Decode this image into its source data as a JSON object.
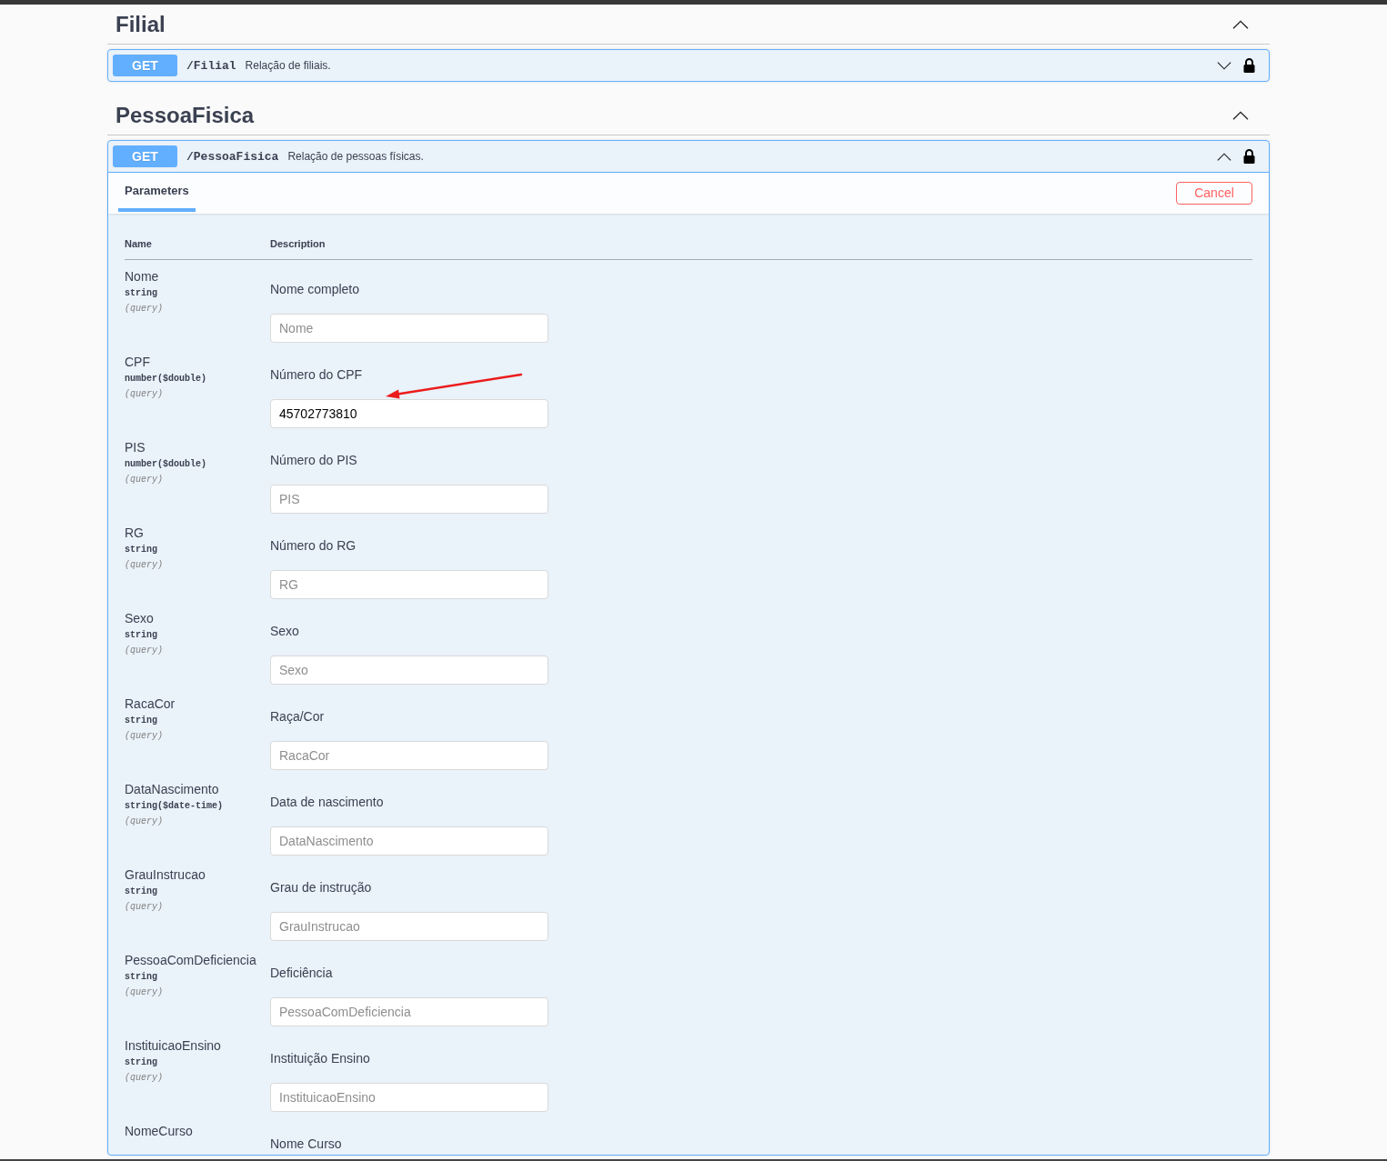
{
  "sections": [
    {
      "title": "Filial",
      "expanded": true,
      "operations": [
        {
          "method": "GET",
          "path": "/Filial",
          "summary": "Relação de filiais.",
          "expanded": false,
          "locked": true
        }
      ]
    },
    {
      "title": "PessoaFisica",
      "expanded": true,
      "operations": [
        {
          "method": "GET",
          "path": "/PessoaFisica",
          "summary": "Relação de pessoas físicas.",
          "expanded": true,
          "locked": true,
          "tabs": [
            {
              "label": "Parameters",
              "selected": true
            }
          ],
          "cancel_button": "Cancel",
          "parameters_table": {
            "columns": [
              "Name",
              "Description"
            ],
            "rows": [
              {
                "name": "Nome",
                "type": "string",
                "location": "(query)",
                "description": "Nome completo",
                "input": {
                  "placeholder": "Nome"
                },
                "annotated": false
              },
              {
                "name": "CPF",
                "type": "number($double)",
                "location": "(query)",
                "description": "Número do CPF",
                "input": {
                  "value": "45702773810"
                },
                "annotated": true
              },
              {
                "name": "PIS",
                "type": "number($double)",
                "location": "(query)",
                "description": "Número do PIS",
                "input": {
                  "placeholder": "PIS"
                },
                "annotated": false
              },
              {
                "name": "RG",
                "type": "string",
                "location": "(query)",
                "description": "Número do RG",
                "input": {
                  "placeholder": "RG"
                },
                "annotated": false
              },
              {
                "name": "Sexo",
                "type": "string",
                "location": "(query)",
                "description": "Sexo",
                "input": {
                  "placeholder": "Sexo"
                },
                "annotated": false
              },
              {
                "name": "RacaCor",
                "type": "string",
                "location": "(query)",
                "description": "Raça/Cor",
                "input": {
                  "placeholder": "RacaCor"
                },
                "annotated": false
              },
              {
                "name": "DataNascimento",
                "type": "string($date-time)",
                "location": "(query)",
                "description": "Data de nascimento",
                "input": {
                  "placeholder": "DataNascimento"
                },
                "annotated": false
              },
              {
                "name": "GrauInstrucao",
                "type": "string",
                "location": "(query)",
                "description": "Grau de instrução",
                "input": {
                  "placeholder": "GrauInstrucao"
                },
                "annotated": false
              },
              {
                "name": "PessoaComDeficiencia",
                "type": "string",
                "location": "(query)",
                "description": "Deficiência",
                "input": {
                  "placeholder": "PessoaComDeficiencia"
                },
                "annotated": false
              },
              {
                "name": "InstituicaoEnsino",
                "type": "string",
                "location": "(query)",
                "description": "Instituição Ensino",
                "input": {
                  "placeholder": "InstituicaoEnsino"
                },
                "annotated": false
              },
              {
                "name": "NomeCurso",
                "description": "Nome Curso",
                "annotated": false
              }
            ]
          }
        }
      ]
    }
  ]
}
